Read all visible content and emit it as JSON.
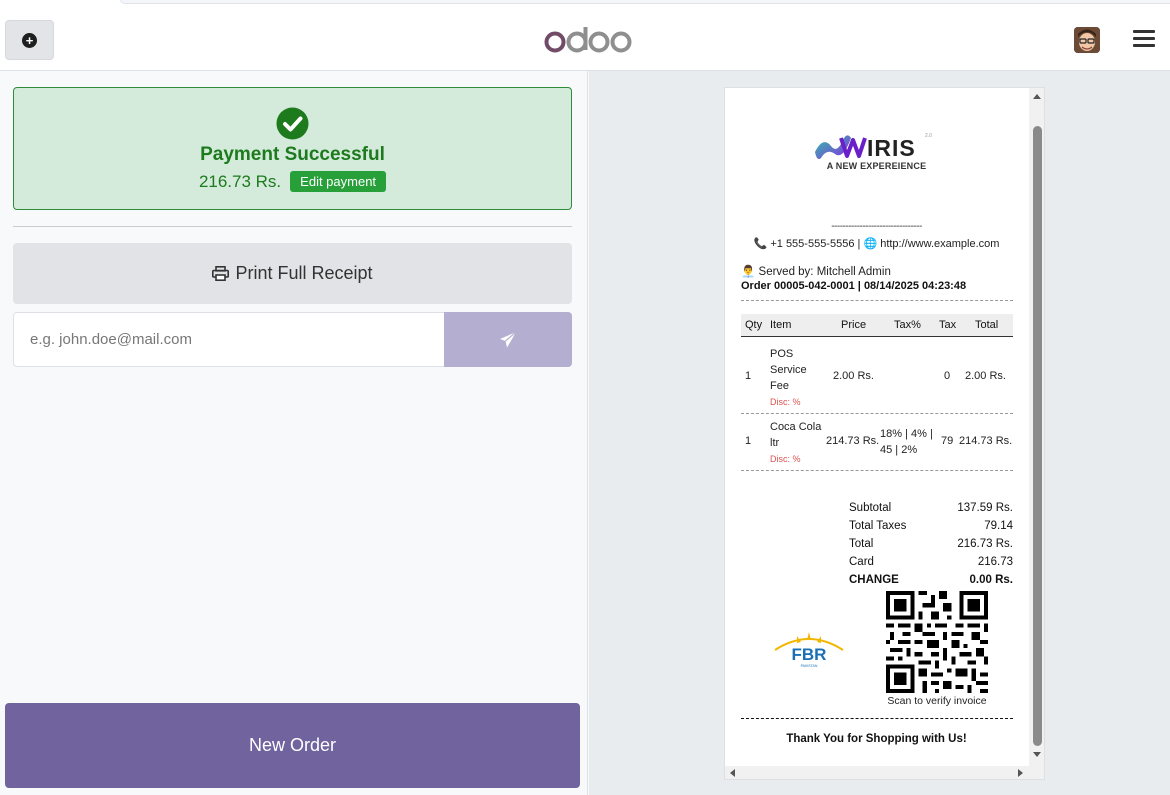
{
  "header": {
    "logo_text": "odoo",
    "new_order_icon": "plus-circle-icon",
    "menu_icon": "hamburger-icon",
    "avatar_icon": "user-avatar-icon"
  },
  "payment": {
    "title": "Payment Successful",
    "amount": "216.73 Rs.",
    "edit_label": "Edit payment"
  },
  "actions": {
    "print_label": "Print Full Receipt",
    "email_placeholder": "e.g. john.doe@mail.com",
    "email_value": "",
    "send_icon": "paper-plane-icon",
    "new_order_label": "New Order"
  },
  "receipt": {
    "brand": "IRIS",
    "brand_version": "2.0",
    "tagline": "A NEW EXPEREIENCE",
    "separator": "--------------------------------",
    "phone": "+1 555-555-5556",
    "website": "http://www.example.com",
    "served_by": "Served by: Mitchell Admin",
    "order_line": "Order 00005-042-0001 | 08/14/2025 04:23:48",
    "columns": [
      "Qty",
      "Item",
      "Price",
      "Tax%",
      "Tax",
      "Total"
    ],
    "lines": [
      {
        "qty": "1",
        "item": [
          "POS",
          "Service",
          "Fee"
        ],
        "disc": "Disc: %",
        "price": "2.00 Rs.",
        "tax_pct": "",
        "tax": "0",
        "total": "2.00 Rs."
      },
      {
        "qty": "1",
        "item": [
          "Coca Cola",
          "ltr"
        ],
        "disc": "Disc: %",
        "price": "214.73 Rs.",
        "tax_pct": [
          "18% | 4% |",
          "45 | 2%"
        ],
        "tax": "79",
        "total": "214.73 Rs."
      }
    ],
    "totals": [
      {
        "label": "Subtotal",
        "value": "137.59 Rs."
      },
      {
        "label": "Total Taxes",
        "value": "79.14"
      },
      {
        "label": "Total",
        "value": "216.73 Rs."
      },
      {
        "label": "Card",
        "value": "216.73"
      },
      {
        "label": "CHANGE",
        "value": "0.00 Rs."
      }
    ],
    "fbr_text": "FBR",
    "fbr_sub": "PAKISTAN",
    "scan_text": "Scan to verify invoice",
    "thanks": "Thank You for Shopping with Us!"
  },
  "colors": {
    "brand_purple": "#71639e",
    "success_green": "#1d7a1d",
    "success_bg": "#d4ebdc",
    "edit_btn_green": "#28a03a",
    "send_btn": "#b4aed0"
  }
}
